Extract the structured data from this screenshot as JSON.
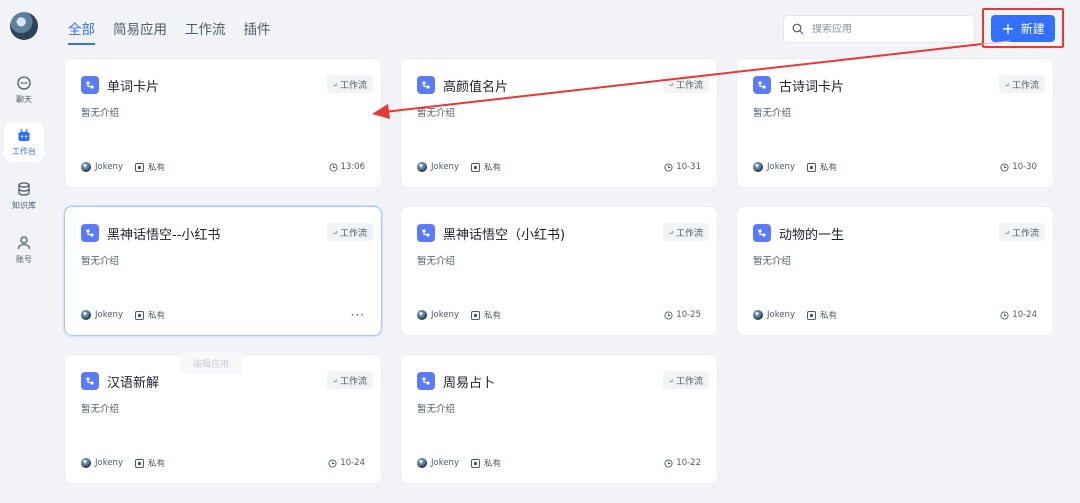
{
  "sidebar": {
    "items": [
      {
        "label": "聊天",
        "icon": "chat-icon"
      },
      {
        "label": "工作台",
        "icon": "robot-icon"
      },
      {
        "label": "知识库",
        "icon": "database-icon"
      },
      {
        "label": "账号",
        "icon": "user-icon"
      }
    ],
    "active_index": 1
  },
  "tabs": [
    {
      "label": "全部"
    },
    {
      "label": "简易应用"
    },
    {
      "label": "工作流"
    },
    {
      "label": "插件"
    }
  ],
  "active_tab": 0,
  "search": {
    "placeholder": "搜索应用",
    "icon": "search-icon"
  },
  "new_button": {
    "label": "新建",
    "icon": "plus-icon"
  },
  "apps": [
    {
      "title": "单词卡片",
      "type": "工作流",
      "desc": "暂无介绍",
      "owner": "Jokeny",
      "privacy": "私有",
      "time": "13:06"
    },
    {
      "title": "高颜值名片",
      "type": "工作流",
      "desc": "暂无介绍",
      "owner": "Jokeny",
      "privacy": "私有",
      "time": "10-31"
    },
    {
      "title": "古诗词卡片",
      "type": "工作流",
      "desc": "暂无介绍",
      "owner": "Jokeny",
      "privacy": "私有",
      "time": "10-30"
    },
    {
      "title": "黑神话悟空--小红书",
      "type": "工作流",
      "desc": "暂无介绍",
      "owner": "Jokeny",
      "privacy": "私有",
      "time": "",
      "hover": true
    },
    {
      "title": "黑神话悟空（小红书)",
      "type": "工作流",
      "desc": "暂无介绍",
      "owner": "Jokeny",
      "privacy": "私有",
      "time": "10-25"
    },
    {
      "title": "动物的一生",
      "type": "工作流",
      "desc": "暂无介绍",
      "owner": "Jokeny",
      "privacy": "私有",
      "time": "10-24"
    },
    {
      "title": "汉语新解",
      "type": "工作流",
      "desc": "暂无介绍",
      "owner": "Jokeny",
      "privacy": "私有",
      "time": "10-24"
    },
    {
      "title": "周易占卜",
      "type": "工作流",
      "desc": "暂无介绍",
      "owner": "Jokeny",
      "privacy": "私有",
      "time": "10-22"
    }
  ],
  "hover_menu": {
    "more_label": "···",
    "tooltip": "编辑应用"
  },
  "colors": {
    "accent": "#3370ff",
    "annotation": "#e53935",
    "background": "#f2f3f7"
  }
}
